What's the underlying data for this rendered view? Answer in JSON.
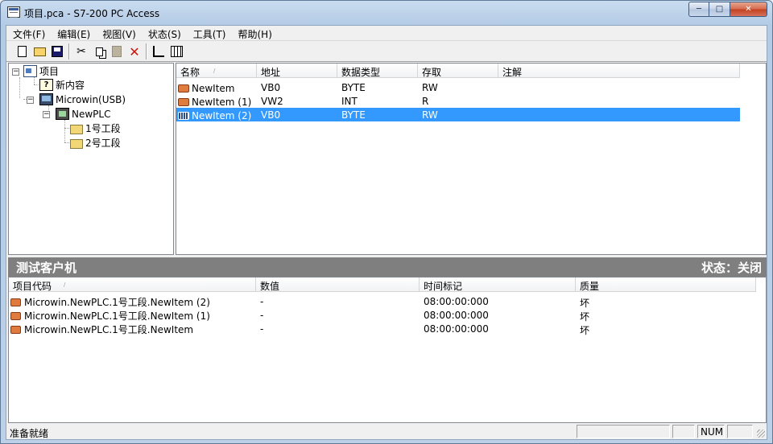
{
  "window": {
    "title": "项目.pca - S7-200 PC Access",
    "min_label": "─",
    "max_label": "□",
    "close_label": "✕"
  },
  "menu": [
    {
      "label": "文件(F)"
    },
    {
      "label": "编辑(E)"
    },
    {
      "label": "视图(V)"
    },
    {
      "label": "状态(S)"
    },
    {
      "label": "工具(T)"
    },
    {
      "label": "帮助(H)"
    }
  ],
  "toolbar": {
    "icons": [
      "new-file-icon",
      "open-folder-icon",
      "save-icon",
      "cut-icon",
      "copy-icon",
      "paste-icon",
      "delete-icon",
      "sort-icon",
      "browse-icon"
    ],
    "cut_glyph": "✂",
    "delete_glyph": "✕"
  },
  "tree": {
    "root": "项目",
    "new_content": "新内容",
    "connection": "Microwin(USB)",
    "plc": "NewPLC",
    "folder1": "1号工段",
    "folder2": "2号工段",
    "expander_minus": "−",
    "help_glyph": "?"
  },
  "items_table": {
    "headers": [
      "名称",
      "地址",
      "数据类型",
      "存取",
      "注解"
    ],
    "sort_glyph": "/",
    "rows": [
      {
        "name": "NewItem",
        "address": "VB0",
        "type": "BYTE",
        "access": "RW",
        "comment": ""
      },
      {
        "name": "NewItem (1)",
        "address": "VW2",
        "type": "INT",
        "access": "R",
        "comment": ""
      },
      {
        "name": "NewItem (2)",
        "address": "VB0",
        "type": "BYTE",
        "access": "RW",
        "comment": ""
      }
    ],
    "selected_row": 2
  },
  "test_client": {
    "title": "测试客户机",
    "status": "状态：关闭",
    "headers": [
      "项目代码",
      "数值",
      "时间标记",
      "质量"
    ],
    "sort_glyph": "/",
    "rows": [
      {
        "code": "Microwin.NewPLC.1号工段.NewItem (2)",
        "value": "-",
        "timestamp": "08:00:00:000",
        "quality": "坏"
      },
      {
        "code": "Microwin.NewPLC.1号工段.NewItem (1)",
        "value": "-",
        "timestamp": "08:00:00:000",
        "quality": "坏"
      },
      {
        "code": "Microwin.NewPLC.1号工段.NewItem",
        "value": "-",
        "timestamp": "08:00:00:000",
        "quality": "坏"
      }
    ]
  },
  "statusbar": {
    "text": "准备就绪",
    "num": "NUM"
  },
  "colors": {
    "selection": "#3399ff",
    "panel_bar": "#7f7f7f"
  }
}
